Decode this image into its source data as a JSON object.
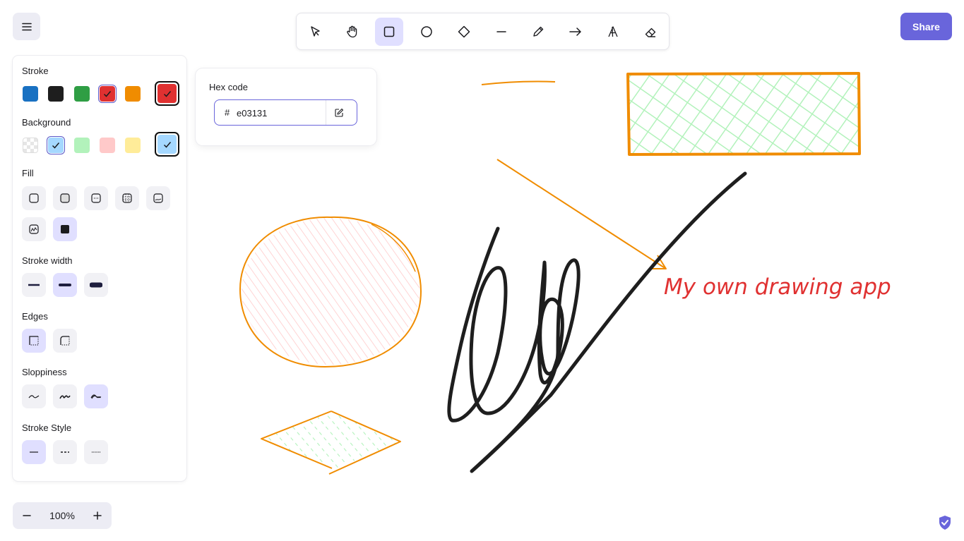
{
  "toolbar": {
    "tools": [
      {
        "name": "selection-tool",
        "icon": "pointer-icon"
      },
      {
        "name": "hand-tool",
        "icon": "hand-icon"
      },
      {
        "name": "rectangle-tool",
        "icon": "rectangle-icon",
        "active": true
      },
      {
        "name": "ellipse-tool",
        "icon": "ellipse-icon"
      },
      {
        "name": "diamond-tool",
        "icon": "diamond-icon"
      },
      {
        "name": "line-tool",
        "icon": "line-icon"
      },
      {
        "name": "pencil-tool",
        "icon": "pencil-icon"
      },
      {
        "name": "arrow-tool",
        "icon": "arrow-icon"
      },
      {
        "name": "text-tool",
        "icon": "text-icon"
      },
      {
        "name": "eraser-tool",
        "icon": "eraser-icon"
      }
    ]
  },
  "share": {
    "label": "Share"
  },
  "panel": {
    "stroke": {
      "label": "Stroke",
      "colors": [
        "#1971c2",
        "#1e1e1e",
        "#2f9e44",
        "#e03131",
        "#f08c00"
      ],
      "selected": "#e03131",
      "current": "#e03131"
    },
    "background": {
      "label": "Background",
      "colors": [
        "transparent",
        "#a5d8ff",
        "#b2f2bb",
        "#ffc9c9",
        "#ffec99"
      ],
      "selected": "#a5d8ff",
      "current": "#a5d8ff"
    },
    "fill": {
      "label": "Fill",
      "options": [
        "hachure",
        "cross-hatch",
        "dots",
        "dashed",
        "zigzag",
        "zigzag-line",
        "solid"
      ],
      "selected": "solid"
    },
    "stroke_width": {
      "label": "Stroke width",
      "options": [
        "thin",
        "bold",
        "extra-bold"
      ],
      "selected": "bold"
    },
    "edges": {
      "label": "Edges",
      "options": [
        "sharp",
        "round"
      ],
      "selected": "sharp"
    },
    "sloppiness": {
      "label": "Sloppiness",
      "options": [
        "architect",
        "artist",
        "cartoonist"
      ],
      "selected": "cartoonist"
    },
    "stroke_style": {
      "label": "Stroke Style",
      "options": [
        "solid",
        "dashed",
        "dotted"
      ],
      "selected": "solid"
    }
  },
  "hex_popover": {
    "label": "Hex code",
    "prefix": "#",
    "value": "e03131"
  },
  "zoom": {
    "value": "100%",
    "minus": "−",
    "plus": "+"
  },
  "canvas": {
    "text_label": "My own drawing app",
    "colors": {
      "orange": "#f08c00",
      "red": "#e03131",
      "green": "#b2f2bb",
      "pink": "#ffc9c9",
      "ink": "#1e1e1e"
    }
  }
}
